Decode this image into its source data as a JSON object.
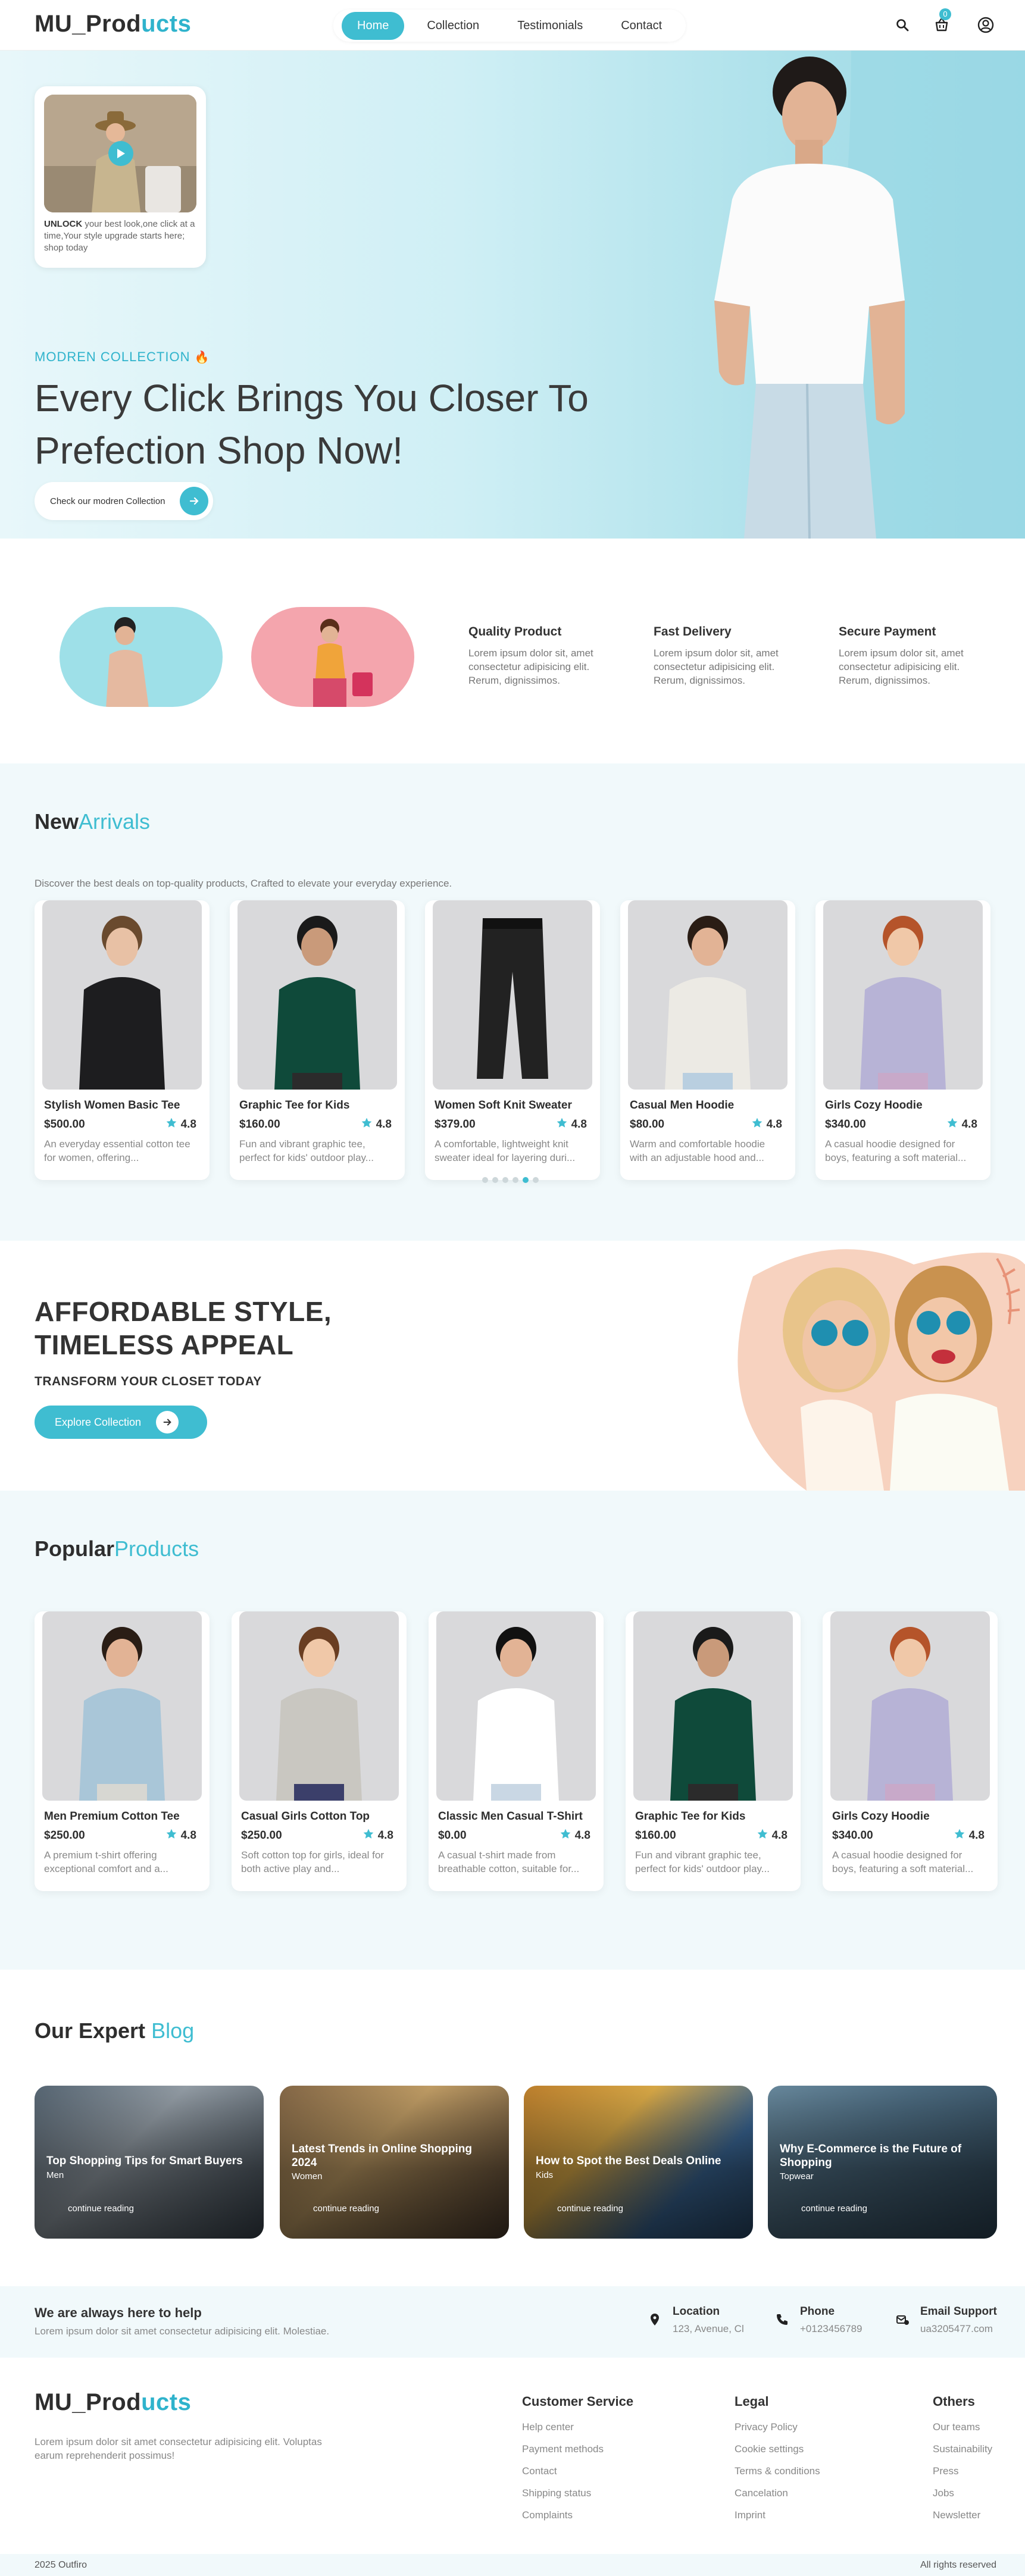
{
  "nav": {
    "logo_main": "MU_Prod",
    "logo_accent": "ucts",
    "links": [
      "Home",
      "Collection",
      "Testimonials",
      "Contact"
    ],
    "cart_count": "0",
    "icons": [
      "search-icon",
      "cart-icon",
      "user-icon"
    ]
  },
  "hero": {
    "video_text_bold": "UNLOCK",
    "video_text": " your best look,one click at a time,Your style upgrade starts here; shop today",
    "tag": "MODREN COLLECTION",
    "title": "Every Click Brings You Closer To Prefection Shop Now!",
    "button": "Check our modren Collection"
  },
  "features": [
    {
      "title": "Quality Product",
      "text": "Lorem ipsum dolor sit, amet consectetur adipisicing elit. Rerum, dignissimos."
    },
    {
      "title": "Fast Delivery",
      "text": "Lorem ipsum dolor sit, amet consectetur adipisicing elit. Rerum, dignissimos."
    },
    {
      "title": "Secure Payment",
      "text": "Lorem ipsum dolor sit, amet consectetur adipisicing elit. Rerum, dignissimos."
    }
  ],
  "arrivals": {
    "title_bold": "New",
    "title_light": "Arrivals",
    "subtitle": "Discover the best deals on top-quality products, Crafted to elevate your everyday experience.",
    "products": [
      {
        "name": "Stylish Women Basic Tee",
        "price": "$500.00",
        "rating": "4.8",
        "desc": "An everyday essential cotton tee for women, offering..."
      },
      {
        "name": "Graphic Tee for Kids",
        "price": "$160.00",
        "rating": "4.8",
        "desc": "Fun and vibrant graphic tee, perfect for kids' outdoor play..."
      },
      {
        "name": "Women Soft Knit Sweater",
        "price": "$379.00",
        "rating": "4.8",
        "desc": "A comfortable, lightweight knit sweater ideal for layering duri..."
      },
      {
        "name": "Casual Men Hoodie",
        "price": "$80.00",
        "rating": "4.8",
        "desc": "Warm and comfortable hoodie with an adjustable hood and..."
      },
      {
        "name": "Girls Cozy Hoodie",
        "price": "$340.00",
        "rating": "4.8",
        "desc": "A casual hoodie designed for boys, featuring a soft material..."
      }
    ],
    "dots_total": 6,
    "dots_active": 5
  },
  "promo": {
    "title": "AFFORDABLE STYLE, TIMELESS APPEAL",
    "subtitle": "TRANSFORM YOUR CLOSET TODAY",
    "button": "Explore Collection"
  },
  "popular": {
    "title_bold": "Popular",
    "title_light": "Products",
    "products": [
      {
        "name": "Men Premium Cotton Tee",
        "price": "$250.00",
        "rating": "4.8",
        "desc": "A premium t-shirt offering exceptional comfort and a..."
      },
      {
        "name": "Casual Girls Cotton Top",
        "price": "$250.00",
        "rating": "4.8",
        "desc": "Soft cotton top for girls, ideal for both active play and..."
      },
      {
        "name": "Classic Men Casual T-Shirt",
        "price": "$0.00",
        "rating": "4.8",
        "desc": "A casual t-shirt made from breathable cotton, suitable for..."
      },
      {
        "name": "Graphic Tee for Kids",
        "price": "$160.00",
        "rating": "4.8",
        "desc": "Fun and vibrant graphic tee, perfect for kids' outdoor play..."
      },
      {
        "name": "Girls Cozy Hoodie",
        "price": "$340.00",
        "rating": "4.8",
        "desc": "A casual hoodie designed for boys, featuring a soft material..."
      }
    ]
  },
  "blog": {
    "title_bold": "Our Expert",
    "title_light": "Blog",
    "posts": [
      {
        "title": "Top Shopping Tips for Smart Buyers",
        "category": "Men",
        "link": "continue reading"
      },
      {
        "title": "Latest Trends in Online Shopping 2024",
        "category": "Women",
        "link": "continue reading"
      },
      {
        "title": "How to Spot the Best Deals Online",
        "category": "Kids",
        "link": "continue reading"
      },
      {
        "title": "Why E-Commerce is the Future of Shopping",
        "category": "Topwear",
        "link": "continue reading"
      }
    ]
  },
  "contact": {
    "title": "We are always here to help",
    "text": "Lorem ipsum dolor sit amet consectetur adipisicing elit. Molestiae.",
    "items": [
      {
        "label": "Location",
        "value": "123, Avenue, Cl"
      },
      {
        "label": "Phone",
        "value": "+0123456789"
      },
      {
        "label": "Email Support",
        "value": "ua3205477.com"
      }
    ]
  },
  "footer": {
    "logo_main": "MU_Prod",
    "logo_accent": "ucts",
    "desc": "Lorem ipsum dolor sit amet consectetur adipisicing elit. Voluptas earum reprehenderit possimus!",
    "columns": [
      {
        "title": "Customer Service",
        "links": [
          "Help center",
          "Payment methods",
          "Contact",
          "Shipping status",
          "Complaints"
        ]
      },
      {
        "title": "Legal",
        "links": [
          "Privacy Policy",
          "Cookie settings",
          "Terms & conditions",
          "Cancelation",
          "Imprint"
        ]
      },
      {
        "title": "Others",
        "links": [
          "Our teams",
          "Sustainability",
          "Press",
          "Jobs",
          "Newsletter"
        ]
      }
    ],
    "copyright": "2025 Outfiro",
    "rights": "All rights reserved"
  },
  "colors": {
    "accent": "#3fbdd1",
    "dark": "#2e2e2e",
    "light_bg": "#f1f9fb"
  }
}
